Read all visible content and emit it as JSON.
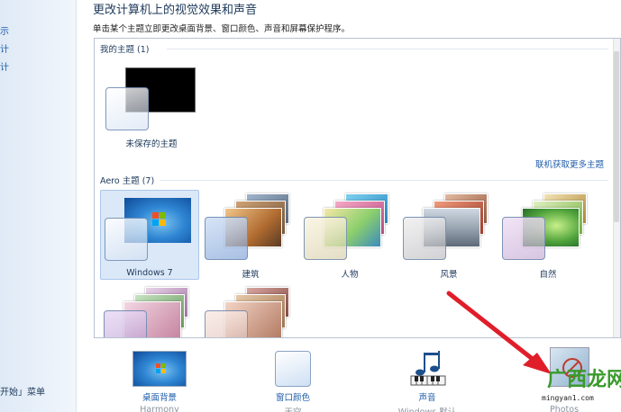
{
  "left_pane": {
    "links": [
      "示",
      "计",
      "计"
    ],
    "bottom_text": "开始」菜单"
  },
  "header": {
    "title": "更改计算机上的视觉效果和声音",
    "subtitle": "单击某个主题立即更改桌面背景、窗口颜色、声音和屏幕保护程序。"
  },
  "my_themes": {
    "header": "我的主题 (1)",
    "items": [
      {
        "label": "未保存的主题"
      }
    ],
    "online_link": "联机获取更多主题"
  },
  "aero_themes": {
    "header": "Aero 主题 (7)",
    "items": [
      {
        "label": "Windows 7",
        "selected": true
      },
      {
        "label": "建筑",
        "selected": false
      },
      {
        "label": "人物",
        "selected": false
      },
      {
        "label": "风景",
        "selected": false
      },
      {
        "label": "自然",
        "selected": false
      },
      {
        "label": "",
        "selected": false
      },
      {
        "label": "",
        "selected": false
      }
    ]
  },
  "bottom_bar": {
    "items": [
      {
        "label": "桌面背景",
        "sub": "Harmony"
      },
      {
        "label": "窗口颜色",
        "sub": "天空"
      },
      {
        "label": "声音",
        "sub": "Windows 默认"
      },
      {
        "label": "",
        "sub": "Photos"
      }
    ]
  },
  "watermark": {
    "text": "广西龙网",
    "url": "mingyan1.com"
  },
  "colors": {
    "link_blue": "#1e5ba8",
    "title_navy": "#1e395b",
    "selection": "#dbe8f7",
    "arrow_red": "#e01e2a"
  }
}
